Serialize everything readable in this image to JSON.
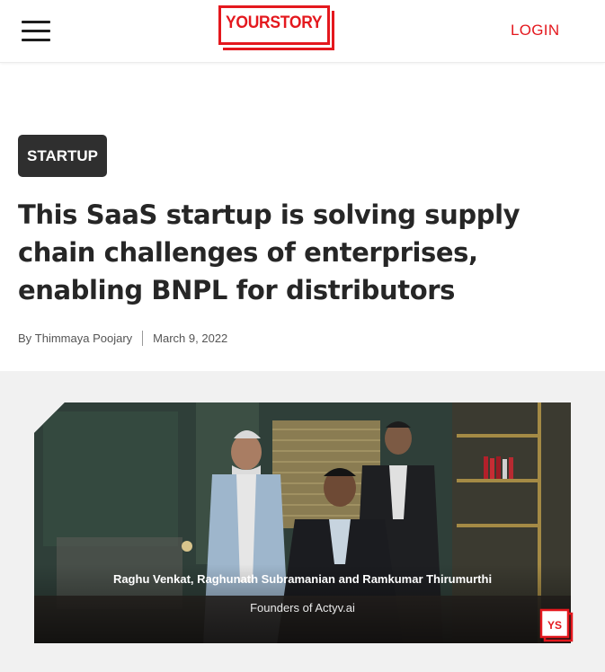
{
  "header": {
    "menu_icon": "hamburger-menu-icon",
    "logo_text": "YOURSTORY",
    "login_label": "LOGIN",
    "accent_color": "#e4181e"
  },
  "article": {
    "category": "STARTUP",
    "title": "This SaaS startup is solving supply chain challenges of enterprises, enabling BNPL for distributors",
    "byline_prefix": "By",
    "author": "Thimmaya Poojary",
    "date": "March 9, 2022"
  },
  "hero_image": {
    "caption_names": "Raghu Venkat, Raghunath Subramanian and Ramkumar Thirumurthi",
    "caption_role": "Founders of Actyv.ai",
    "badge_text": "YS"
  }
}
